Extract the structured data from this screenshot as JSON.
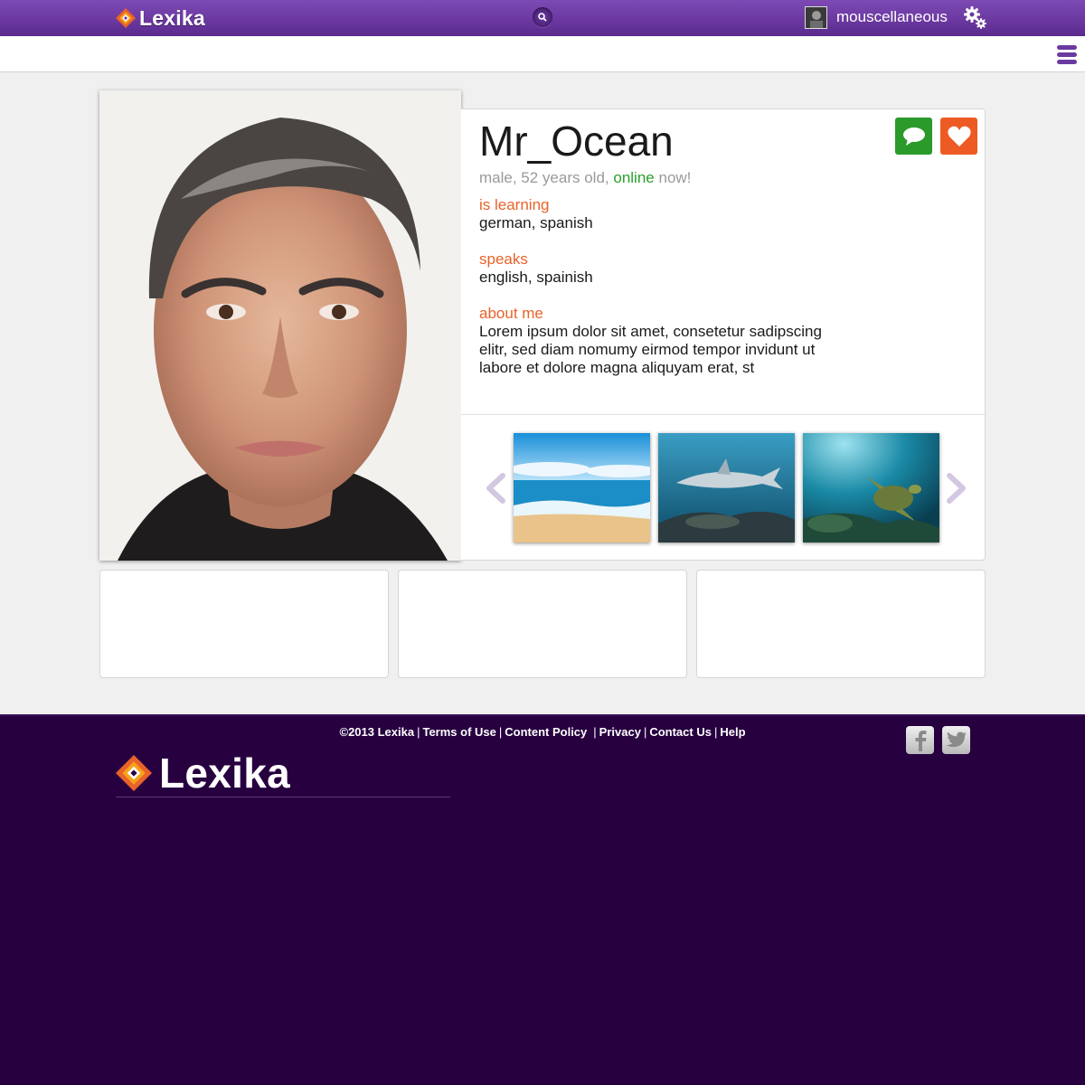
{
  "brand": {
    "name": "Lexika"
  },
  "header": {
    "username": "mouscellaneous",
    "icons": {
      "search": "search-icon",
      "settings": "gears-icon",
      "menu": "hamburger-menu-icon"
    }
  },
  "profile": {
    "name": "Mr_Ocean",
    "meta_prefix": "male, 52 years old,",
    "status": "online",
    "meta_suffix": "now!",
    "learning_label": "is learning",
    "learning_value": "german, spanish",
    "speaks_label": "speaks",
    "speaks_value": "english, spainish",
    "about_label": "about me",
    "about_value": "Lorem ipsum dolor sit amet, consetetur sadipscing elitr, sed diam nomumy eirmod tempor invidunt ut labore et dolore magna aliquyam erat, st",
    "actions": {
      "message_icon": "speech-bubble-icon",
      "like_icon": "heart-icon"
    }
  },
  "gallery": {
    "photos": [
      "beach-photo",
      "shark-photo",
      "sea-turtle-photo"
    ]
  },
  "footer": {
    "copyright": "©2013 Lexika",
    "links": [
      "Terms of Use",
      "Content Policy",
      "Privacy",
      "Contact Us",
      "Help"
    ],
    "social": [
      "facebook-icon",
      "twitter-icon"
    ]
  },
  "colors": {
    "brand_purple": "#6b3aa0",
    "footer_bg": "#270040",
    "accent_orange": "#e8622a",
    "online_green": "#2aa02a",
    "message_green": "#2a9a2a",
    "like_orange": "#ee5a24"
  }
}
